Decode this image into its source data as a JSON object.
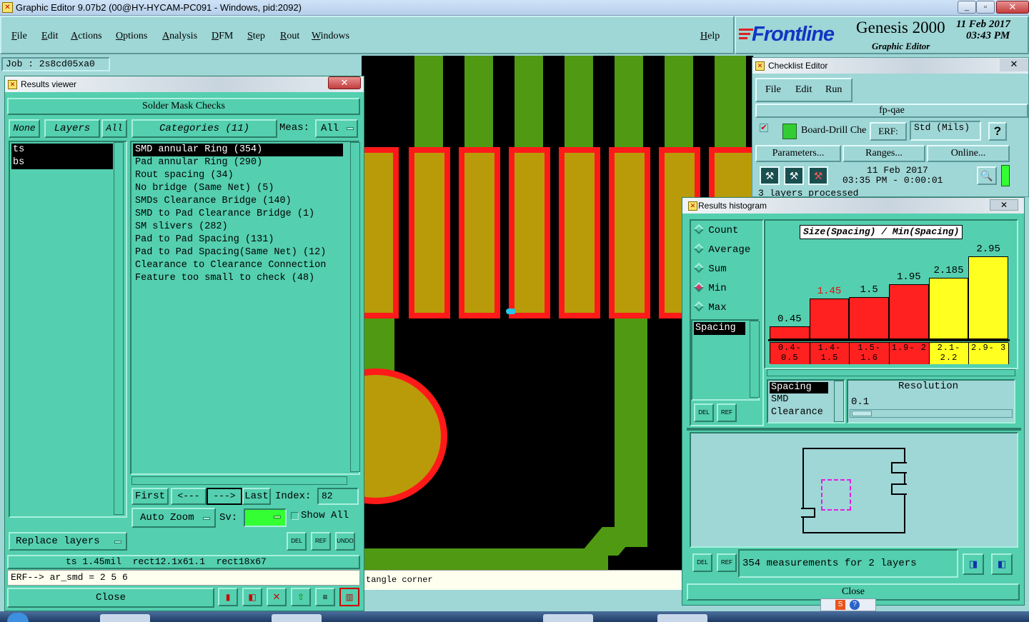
{
  "app": {
    "title": "Graphic Editor 9.07b2 (00@HY-HYCAM-PC091 - Windows, pid:2092)",
    "menus": [
      "File",
      "Edit",
      "Actions",
      "Options",
      "Analysis",
      "DFM",
      "Step",
      "Rout",
      "Windows"
    ],
    "help": "Help",
    "brand": "Frontline",
    "product": "Genesis 2000",
    "product_sub": "Graphic Editor",
    "date": "11 Feb 2017",
    "time": "03:43 PM",
    "job": "Job : 2s8cd05xa0"
  },
  "results_viewer": {
    "title": "Results viewer",
    "header": "Solder Mask Checks",
    "none_btn": "None",
    "layers_btn": "Layers",
    "all_btn": "All",
    "categories_btn": "Categories (11)",
    "meas_label": "Meas:",
    "meas_value": "All",
    "layers": [
      "ts",
      "bs"
    ],
    "categories": [
      "SMD annular Ring (354)",
      "Pad annular Ring (290)",
      "Rout spacing (34)",
      "No bridge (Same Net) (5)",
      "SMDs Clearance Bridge (140)",
      "SMD to Pad Clearance Bridge (1)",
      "SM slivers (282)",
      "Pad to Pad Spacing (131)",
      "Pad to Pad Spacing(Same Net) (12)",
      "Clearance to Clearance Connection",
      "Feature too small to check (48)"
    ],
    "nav": {
      "first": "First",
      "prev": "<---",
      "next": "--->",
      "last": "Last",
      "index_label": "Index:",
      "index_value": "82"
    },
    "auto_zoom": "Auto Zoom",
    "sv_label": "Sv:",
    "show_all": "Show All",
    "replace_layers": "Replace layers",
    "icons": {
      "del": "DEL",
      "ref": "REF",
      "undo": "UNDO"
    },
    "measure_line": "ts 1.45mil  rect12.1x61.1  rect18x67",
    "erf_line": "ERF--> ar_smd = 2 5 6",
    "close": "Close"
  },
  "canvas": {
    "status_text": "tangle corner"
  },
  "checklist": {
    "title": "Checklist Editor",
    "menus": [
      "File",
      "Edit",
      "Run"
    ],
    "name": "fp-qae",
    "row_label": "Board-Drill Che",
    "erf_label": "ERF:",
    "std_value": "Std (Mils)",
    "help": "?",
    "parameters": "Parameters...",
    "ranges": "Ranges...",
    "online": "Online...",
    "run_date": "11 Feb 2017",
    "run_time": "03:35 PM - 0:00:01",
    "status_line": "3 layers processed"
  },
  "histogram": {
    "title": "Results histogram",
    "options": [
      "Count",
      "Average",
      "Sum",
      "Min",
      "Max"
    ],
    "selected_option": "Min",
    "metrics": [
      "Spacing"
    ],
    "chart_title": "Size(Spacing) / Min(Spacing)",
    "bars": [
      {
        "label": "0.45",
        "bin": "0.4- 0.5",
        "value": 0.45,
        "color": "#ff2020",
        "label_color": "#000000"
      },
      {
        "label": "1.45",
        "bin": "1.4- 1.5",
        "value": 1.45,
        "color": "#ff2020",
        "label_color": "#e01010"
      },
      {
        "label": "1.5",
        "bin": "1.5- 1.6",
        "value": 1.5,
        "color": "#ff2020",
        "label_color": "#000000"
      },
      {
        "label": "1.95",
        "bin": "1.9- 2",
        "value": 1.95,
        "color": "#ff2020",
        "label_color": "#000000"
      },
      {
        "label": "2.185",
        "bin": "2.1- 2.2",
        "value": 2.185,
        "color": "#ffff20",
        "label_color": "#000000"
      },
      {
        "label": "2.95",
        "bin": "2.9- 3",
        "value": 2.95,
        "color": "#ffff20",
        "label_color": "#000000"
      }
    ],
    "types": [
      "Spacing",
      "SMD",
      "Clearance"
    ],
    "resolution_label": "Resolution",
    "resolution_value": "0.1",
    "summary": "354 measurements for 2 layers",
    "close": "Close",
    "icons": {
      "del": "DEL",
      "ref": "REF"
    }
  }
}
